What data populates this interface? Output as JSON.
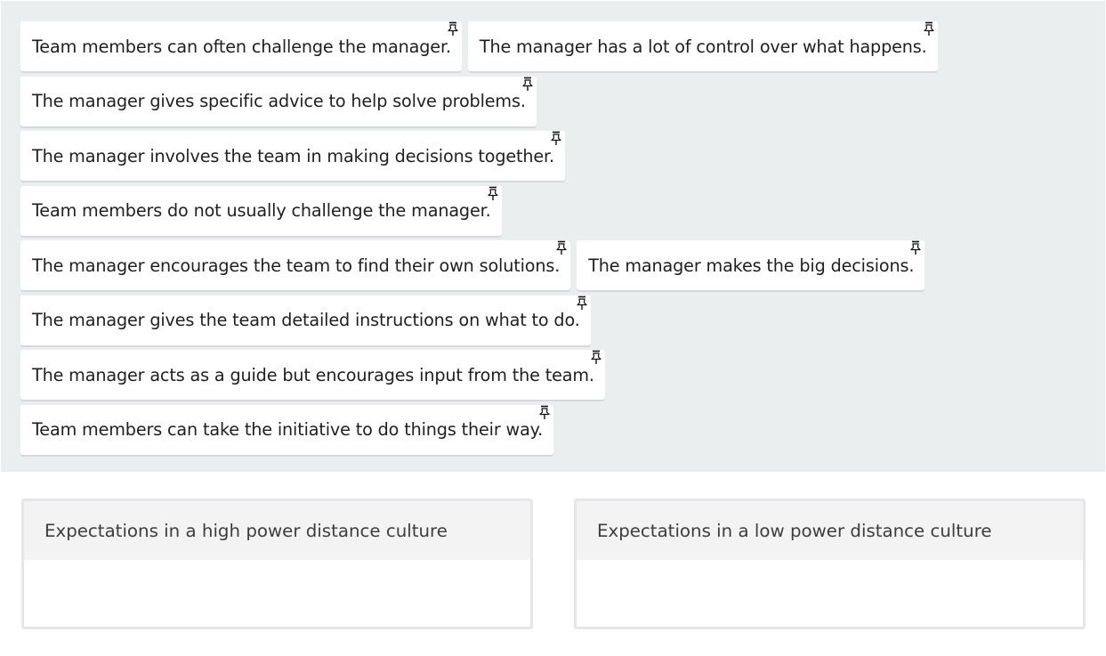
{
  "pool": {
    "rows": [
      [
        "Team members can often challenge the manager.",
        "The manager has a lot of control over what happens."
      ],
      [
        "The manager gives specific advice to help solve problems."
      ],
      [
        "The manager involves the team in making decisions together."
      ],
      [
        "Team members do not usually challenge the manager."
      ],
      [
        "The manager encourages the team to find their own solutions.",
        "The manager makes the big decisions."
      ],
      [
        "The manager gives the team detailed instructions on what to do."
      ],
      [
        "The manager acts as a guide but encourages input from the team."
      ],
      [
        "Team members can take the initiative to do things their way."
      ]
    ]
  },
  "zones": {
    "high": {
      "title": "Expectations in a high power distance culture"
    },
    "low": {
      "title": "Expectations in a low power distance culture"
    }
  },
  "icons": {
    "chip_handle": "pin-icon"
  }
}
